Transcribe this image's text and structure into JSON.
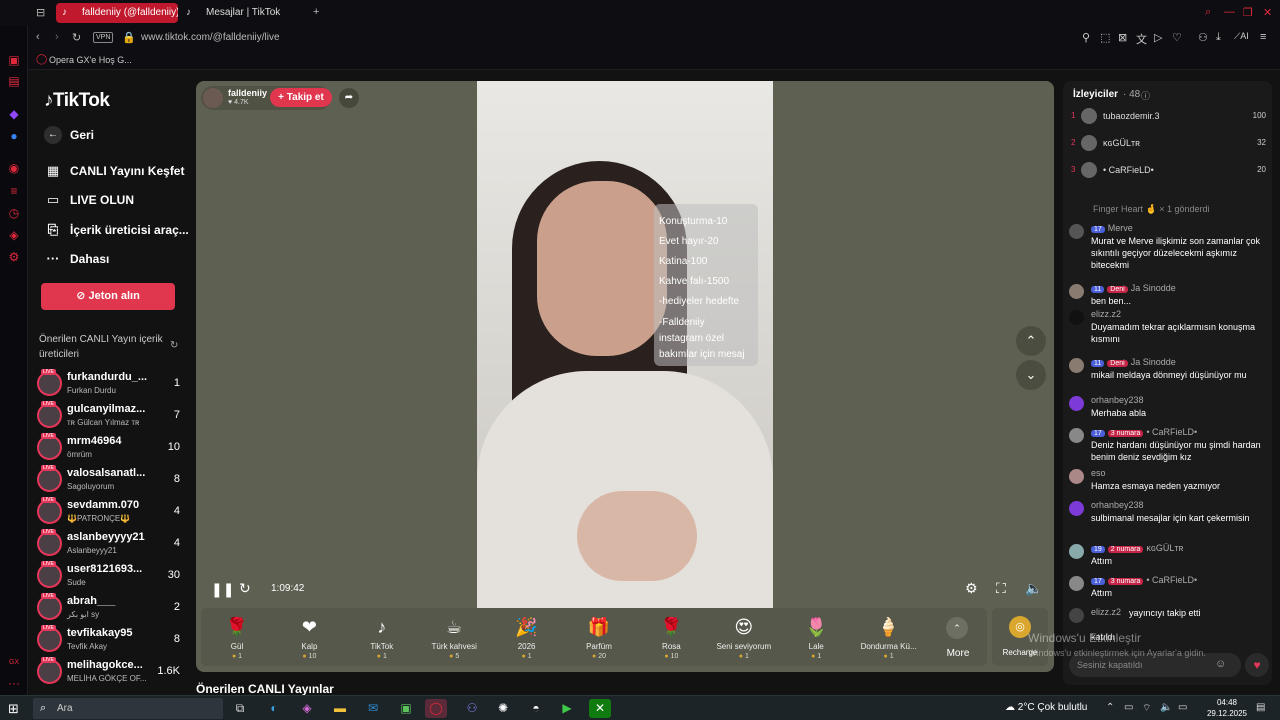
{
  "browser": {
    "tabs": [
      {
        "label": "falldeniiy (@falldeniiy)",
        "active": true,
        "icon": "tiktok-icon"
      },
      {
        "label": "Mesajlar | TikTok",
        "active": false,
        "icon": "tiktok-icon"
      }
    ],
    "vpn_label": "VPN",
    "url": "www.tiktok.com/@falldeniiy/live",
    "bookmark": "Opera GX'e Hoş G...",
    "accent": "#c0182c"
  },
  "sidebar": {
    "logo": "TikTok",
    "nav": [
      {
        "label": "Geri",
        "icon": "back-arrow-icon"
      },
      {
        "label": "CANLI Yayını Keşfet",
        "icon": "live-explore-icon"
      },
      {
        "label": "LIVE OLUN",
        "icon": "camera-icon"
      },
      {
        "label": "İçerik üreticisi araç...",
        "icon": "creator-tools-icon"
      },
      {
        "label": "Dahası",
        "icon": "more-dots-icon"
      }
    ],
    "jeton_button": "Jeton alın",
    "suggested_title": "Önerilen CANLI Yayın içerik üreticileri",
    "creators": [
      {
        "name": "furkandurdu_...",
        "sub": "Furkan Durdu",
        "count": "1"
      },
      {
        "name": "gulcanyilmaz...",
        "sub": "ᴛʀ Gülcan Yılmaz ᴛʀ",
        "count": "7"
      },
      {
        "name": "mrm46964",
        "sub": "ömrüm",
        "count": "10"
      },
      {
        "name": "valosalsanatl...",
        "sub": "Sagoluyorum",
        "count": "8"
      },
      {
        "name": "sevdamm.070",
        "sub": "🔱PATRONÇE🔱",
        "count": "4"
      },
      {
        "name": "aslanbeyyyy21",
        "sub": "Aslanbeyyy21",
        "count": "4"
      },
      {
        "name": "user8121693...",
        "sub": "Sude",
        "count": "30"
      },
      {
        "name": "abrah___",
        "sub": "ابو بكر sy",
        "count": "2"
      },
      {
        "name": "tevfikakay95",
        "sub": "Tevfik Akay",
        "count": "8"
      },
      {
        "name": "melihagokce...",
        "sub": "MELİHA GÖKÇE OF...",
        "count": "1.6K"
      }
    ]
  },
  "stream": {
    "host_name": "falldeniiy",
    "host_likes": "♥ 4.7K",
    "follow_button": "+ Takip et",
    "overlay_lines": [
      "Konuşturma-10",
      "Evet hayır-20",
      "Katina-100",
      "Kahve falı-1500",
      "-hediyeler hedefte",
      "-Falldeniiy",
      "instagram özel",
      "bakımlar için mesaj"
    ],
    "elapsed": "1:09:42",
    "next_title": "Önerilen CANLI Yayınlar"
  },
  "gifts": [
    {
      "name": "Gül",
      "price": "1",
      "icon": "🌹"
    },
    {
      "name": "Kalp",
      "price": "10",
      "icon": "❤"
    },
    {
      "name": "TikTok",
      "price": "1",
      "icon": "♪"
    },
    {
      "name": "Türk kahvesi",
      "price": "5",
      "icon": "☕"
    },
    {
      "name": "2026",
      "price": "1",
      "icon": "🎉"
    },
    {
      "name": "Parfüm",
      "price": "20",
      "icon": "🎁"
    },
    {
      "name": "Rosa",
      "price": "10",
      "icon": "🌹"
    },
    {
      "name": "Seni seviyorum",
      "price": "1",
      "icon": "😍"
    },
    {
      "name": "Lale",
      "price": "1",
      "icon": "🌷"
    },
    {
      "name": "Dondurma Kü...",
      "price": "1",
      "icon": "🍦"
    }
  ],
  "gift_more": "More",
  "recharge": "Recharge",
  "chat": {
    "viewers_title": "İzleyiciler",
    "viewers_count": "· 48",
    "top_viewers": [
      {
        "rank": "1",
        "name": "tubaozdemir.3",
        "score": "100"
      },
      {
        "rank": "2",
        "name": "ĸɢGÜLᴛʀ",
        "score": "32"
      },
      {
        "rank": "3",
        "name": "• CaRFieLD•",
        "score": "20"
      }
    ],
    "gift_notice": "Finger Heart 🤞 × 1 gönderdi",
    "messages": [
      {
        "level": "17",
        "fan": "",
        "name": "Merve",
        "text": "Murat ve Merve ilişkimiz son zamanlar çok sıkıntılı geçiyor düzelecekmi aşkımız bitecekmi"
      },
      {
        "level": "11",
        "fan": "Deni",
        "name": "Ja Sinodde",
        "text": "ben ben..."
      },
      {
        "level": "",
        "fan": "",
        "name": "elizz.z2",
        "text": "Duyamadım tekrar açıklarmısın konuşma kısmını"
      },
      {
        "level": "11",
        "fan": "Deni",
        "name": "Ja Sinodde",
        "text": "mikail meldaya dönmeyi düşünüyor mu"
      },
      {
        "level": "",
        "fan": "",
        "name": "orhanbey238",
        "text": "Merhaba abla"
      },
      {
        "level": "17",
        "fan": "3 numara",
        "name": "• CaRFieLD•",
        "text": "Deniz hardanı düşünüyor mu şimdi hardan benim deniz sevdiğim kız"
      },
      {
        "level": "",
        "fan": "",
        "name": "eso",
        "text": "Hamza esmaya neden yazmıyor"
      },
      {
        "level": "",
        "fan": "",
        "name": "orhanbey238",
        "text": "sulbimanal mesajlar için kart çekermisin"
      },
      {
        "level": "19",
        "fan": "2 numara",
        "name": "ĸɢGÜLᴛʀ",
        "text": "Attım"
      },
      {
        "level": "17",
        "fan": "3 numara",
        "name": "• CaRFieLD•",
        "text": "Attım"
      },
      {
        "level": "",
        "fan": "",
        "name": "elizz.z2",
        "text": "yayıncıyı takip etti"
      }
    ],
    "last_join": "katıldı",
    "input_placeholder": "Sesiniz kapatıldı"
  },
  "windows": {
    "watermark_title": "Windows'u Etkinleştir",
    "watermark_sub": "Windows'u etkinleştirmek için Ayarlar'a gidin.",
    "search_label": "Ara",
    "weather": "2°C  Çok bulutlu",
    "time": "04:48",
    "date": "29.12.2025"
  }
}
